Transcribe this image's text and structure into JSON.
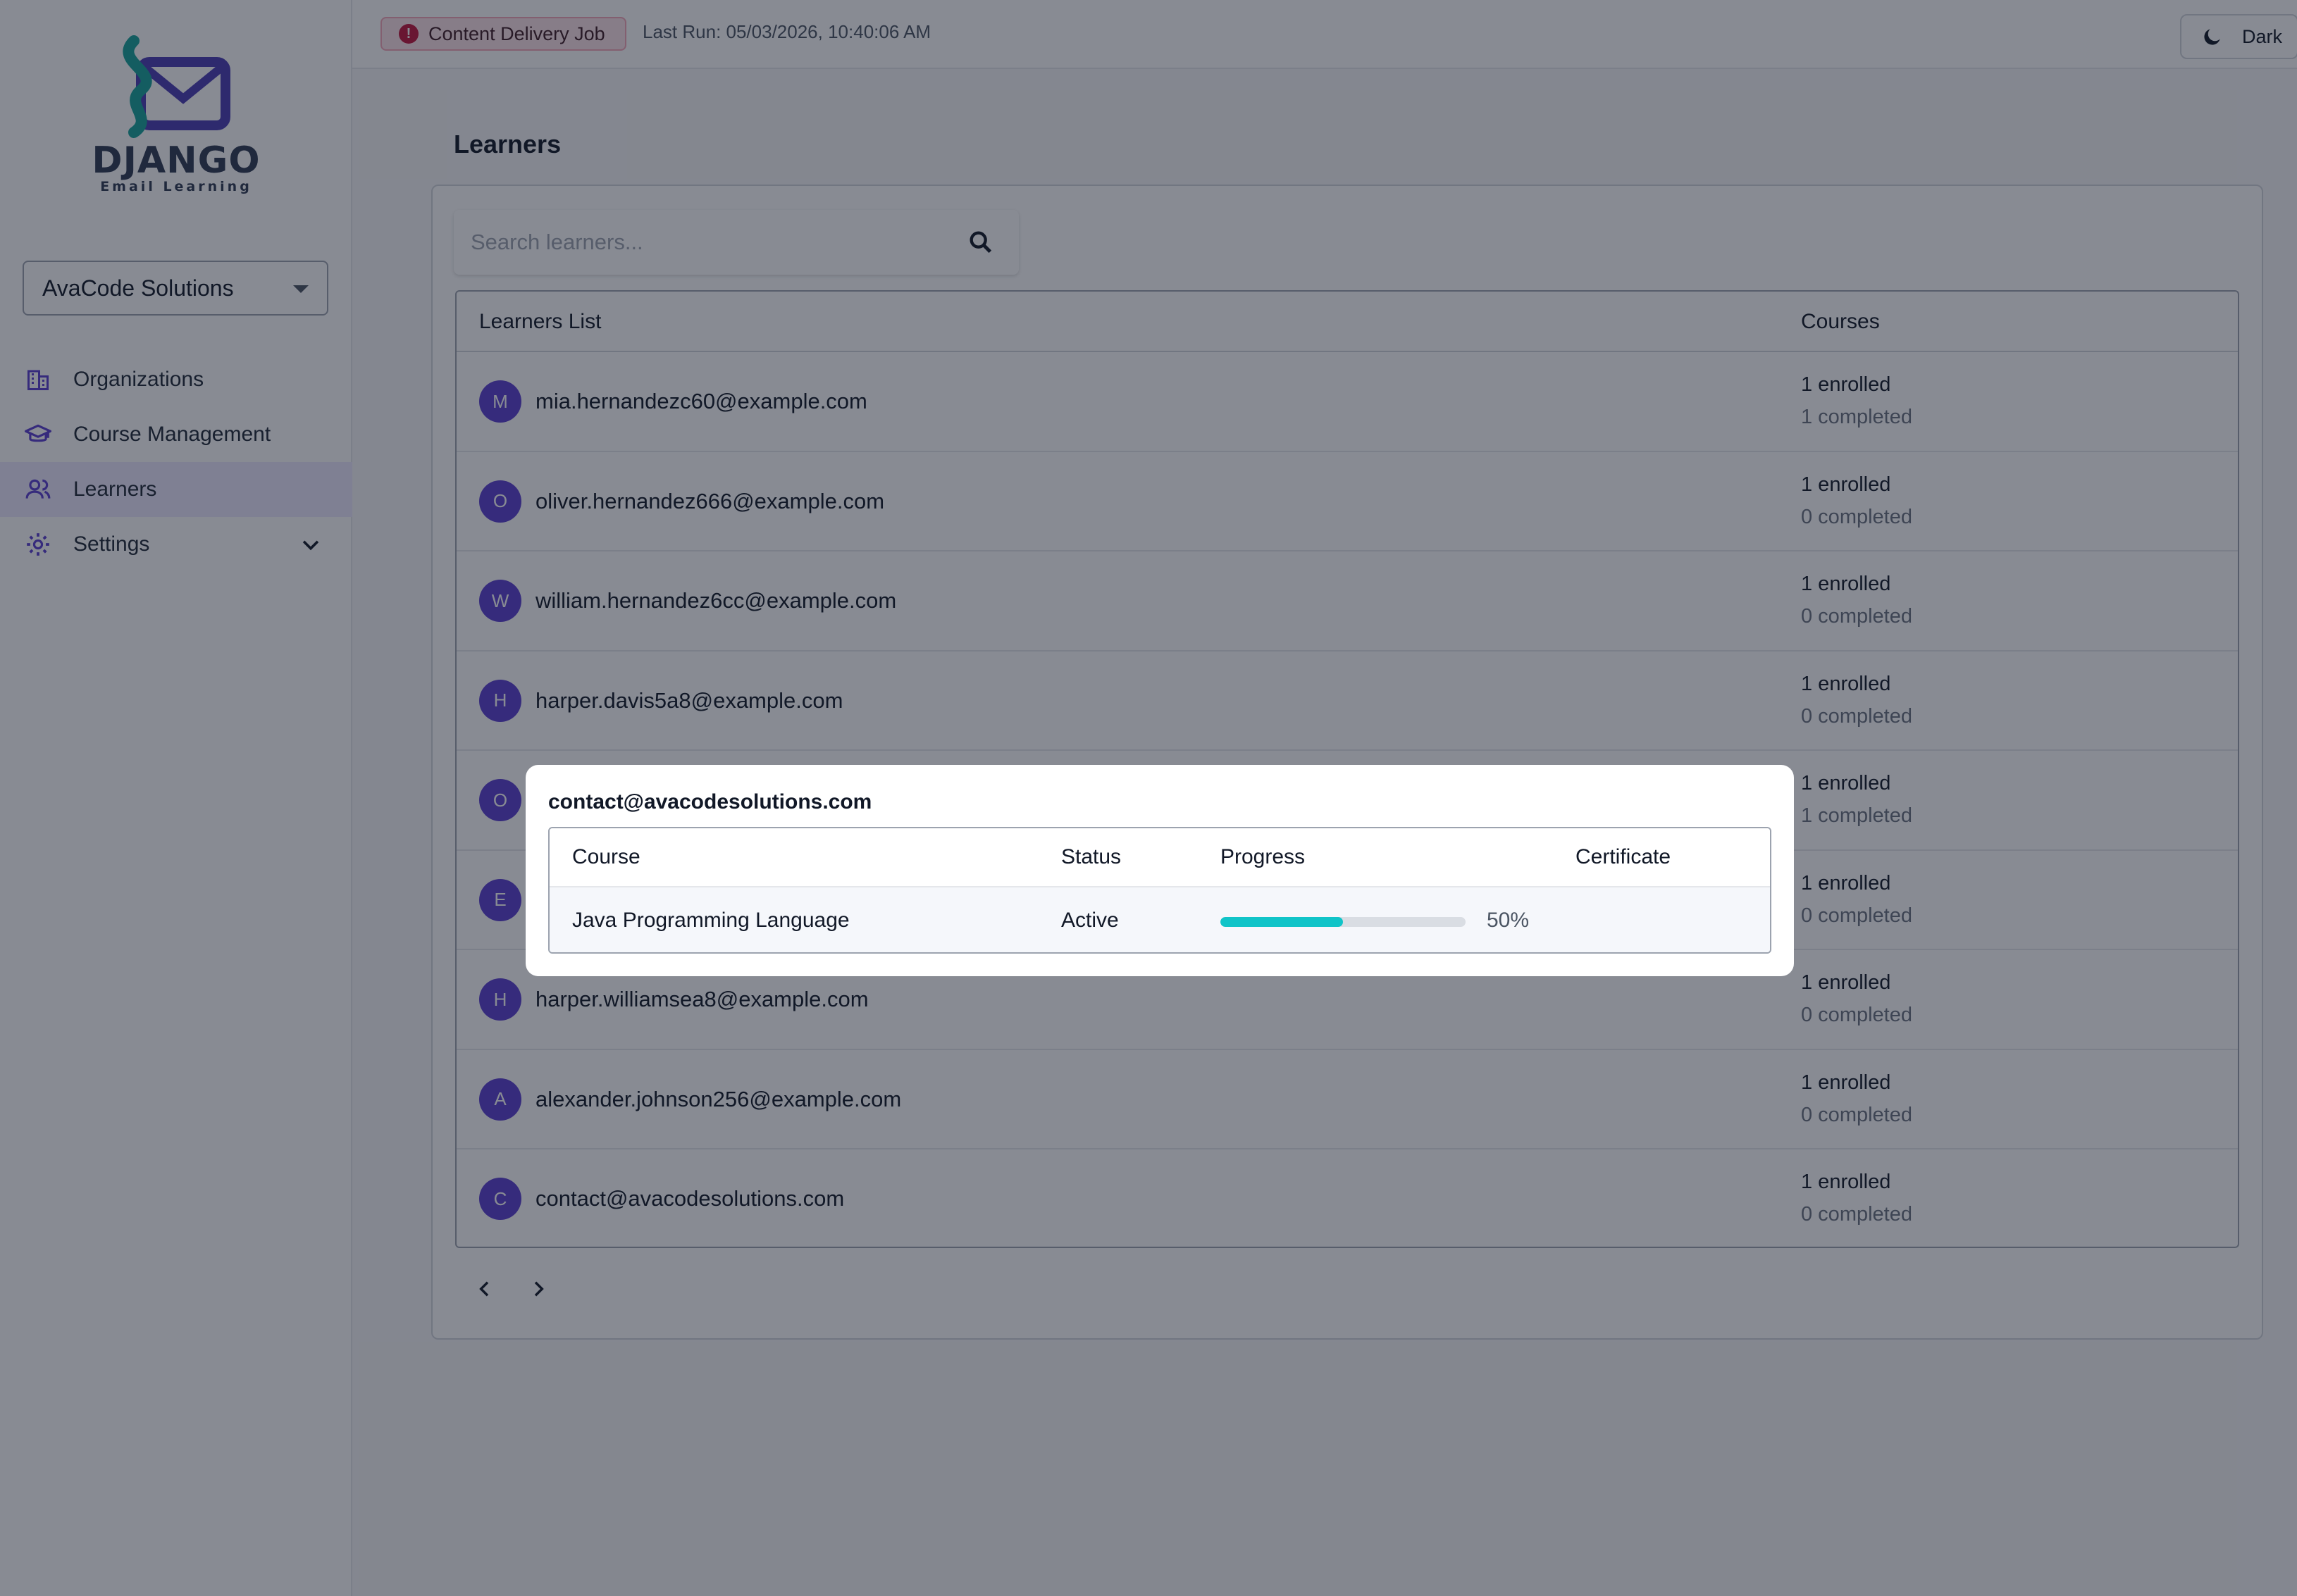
{
  "app": {
    "logo_word": "DJANGO",
    "logo_sub": "Email Learning"
  },
  "sidebar": {
    "org_select_value": "AvaCode Solutions",
    "items": [
      {
        "label": "Organizations",
        "icon": "building-icon"
      },
      {
        "label": "Course Management",
        "icon": "graduation-cap-icon"
      },
      {
        "label": "Learners",
        "icon": "users-icon"
      },
      {
        "label": "Settings",
        "icon": "gear-icon"
      }
    ]
  },
  "topbar": {
    "job_label": "Content Delivery Job",
    "last_run": "Last Run: 05/03/2026, 10:40:06 AM",
    "theme_label": "Dark"
  },
  "main": {
    "title": "Learners",
    "search_placeholder": "Search learners...",
    "table": {
      "col_learners": "Learners List",
      "col_courses": "Courses",
      "rows": [
        {
          "initial": "M",
          "email": "mia.hernandezc60@example.com",
          "enrolled": "1 enrolled",
          "completed": "1 completed"
        },
        {
          "initial": "O",
          "email": "oliver.hernandez666@example.com",
          "enrolled": "1 enrolled",
          "completed": "0 completed"
        },
        {
          "initial": "W",
          "email": "william.hernandez6cc@example.com",
          "enrolled": "1 enrolled",
          "completed": "0 completed"
        },
        {
          "initial": "H",
          "email": "harper.davis5a8@example.com",
          "enrolled": "1 enrolled",
          "completed": "0 completed"
        },
        {
          "initial": "O",
          "email": "",
          "enrolled": "1 enrolled",
          "completed": "1 completed"
        },
        {
          "initial": "E",
          "email": "",
          "enrolled": "1 enrolled",
          "completed": "0 completed"
        },
        {
          "initial": "H",
          "email": "harper.williamsea8@example.com",
          "enrolled": "1 enrolled",
          "completed": "0 completed"
        },
        {
          "initial": "A",
          "email": "alexander.johnson256@example.com",
          "enrolled": "1 enrolled",
          "completed": "0 completed"
        },
        {
          "initial": "C",
          "email": "contact@avacodesolutions.com",
          "enrolled": "1 enrolled",
          "completed": "0 completed"
        }
      ]
    }
  },
  "modal": {
    "title": "contact@avacodesolutions.com",
    "headers": {
      "course": "Course",
      "status": "Status",
      "progress": "Progress",
      "certificate": "Certificate"
    },
    "rows": [
      {
        "course": "Java Programming Language",
        "status": "Active",
        "progress_percent": 50,
        "progress_label": "50%",
        "certificate": ""
      }
    ]
  },
  "colors": {
    "accent": "#5b3fd0",
    "progress": "#10c4c8",
    "alert": "#c0143c"
  }
}
